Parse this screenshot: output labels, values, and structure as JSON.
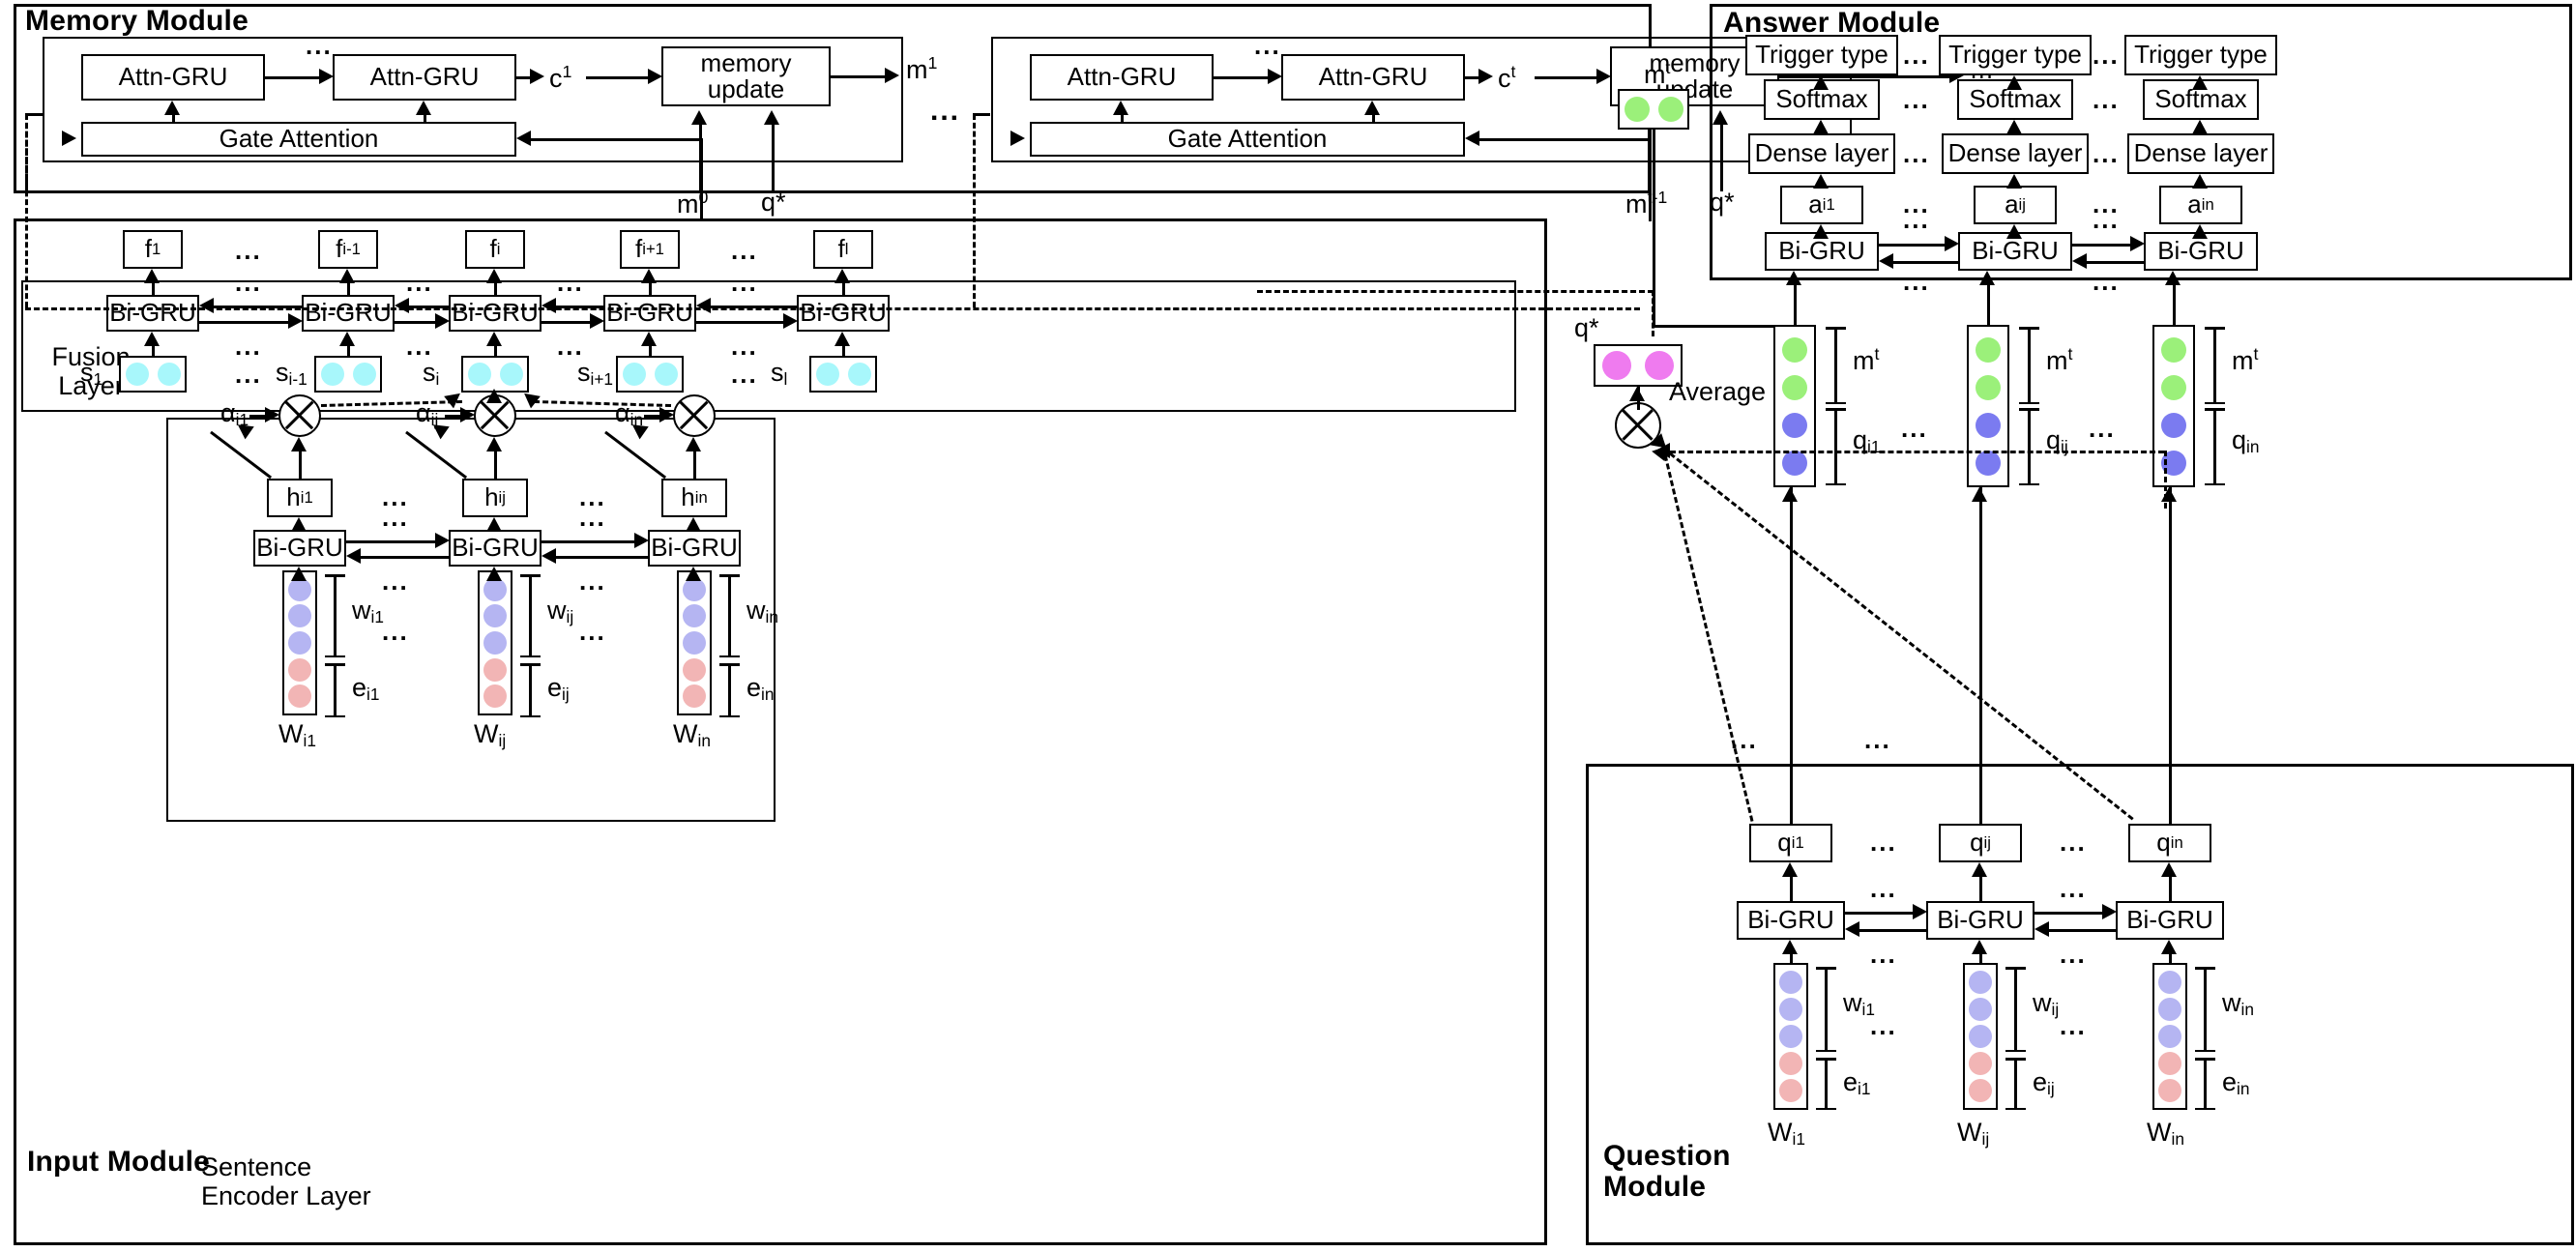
{
  "figure": {
    "type": "neural-network-architecture-diagram",
    "modules": [
      "Memory Module",
      "Answer Module",
      "Input Module",
      "Question Module"
    ]
  },
  "colors": {
    "memory_green": "#9bf07a",
    "question_blue": "#7b7bf0",
    "qstar_magenta": "#ef7bef",
    "sentence_cyan": "#a8f7fb",
    "word_lavender": "#b5b5f2",
    "entity_pink": "#f2b5b5",
    "stroke": "#000000",
    "background": "#ffffff"
  },
  "memory_module": {
    "title": "Memory Module",
    "ellipsis_between_steps": "...",
    "steps": [
      {
        "attn_gru_left": "Attn-GRU",
        "attn_gru_right": "Attn-GRU",
        "inner_dots": "...",
        "context_label": "c1",
        "context_sup": "1",
        "memory_update": "memory\nupdate",
        "memory_out": "m1",
        "memory_out_sup": "1",
        "gate": "Gate Attention",
        "input_prev_memory": "m0",
        "input_prev_memory_sup": "0",
        "input_question": "q*"
      },
      {
        "attn_gru_left": "Attn-GRU",
        "attn_gru_right": "Attn-GRU",
        "inner_dots": "...",
        "context_label": "ct",
        "context_sup": "t",
        "memory_update": "memory\nupdate",
        "memory_out": "mt",
        "memory_out_sup": "t",
        "gate": "Gate Attention",
        "input_prev_memory": "mt-1",
        "input_prev_memory_sup": "t-1",
        "input_question": "q*"
      }
    ]
  },
  "memory_vector": {
    "label": "m",
    "sup": "t",
    "dot_count": 2,
    "color": "#9bf07a"
  },
  "answer_module": {
    "title": "Answer Module",
    "ellipsis": "...",
    "rows": {
      "trigger": "Trigger type",
      "softmax": "Softmax",
      "dense": "Dense layer",
      "bigru": "Bi-GRU"
    },
    "columns": [
      {
        "attention": "a",
        "attention_sub": "i1"
      },
      {
        "attention": "a",
        "attention_sub": "ij"
      },
      {
        "attention": "a",
        "attention_sub": "in"
      }
    ]
  },
  "answer_inputs": [
    {
      "memory_label": "m",
      "memory_sup": "t",
      "question_label": "q",
      "question_sub": "i1",
      "green_dots": 2,
      "blue_dots": 2
    },
    {
      "memory_label": "m",
      "memory_sup": "t",
      "question_label": "q",
      "question_sub": "ij",
      "green_dots": 2,
      "blue_dots": 2
    },
    {
      "memory_label": "m",
      "memory_sup": "t",
      "question_label": "q",
      "question_sub": "in",
      "green_dots": 2,
      "blue_dots": 2
    }
  ],
  "qstar": {
    "label": "q*",
    "average_label": "Average",
    "dot_count": 2,
    "color": "#ef7bef"
  },
  "input_module": {
    "title": "Input Module",
    "fusion_layer_label": "Fusion\nLayer",
    "sentence_encoder_label": "Sentence\nEncoder Layer",
    "bigru_label": "Bi-GRU",
    "ellipsis": "...",
    "fusion_columns": [
      {
        "f": "f",
        "f_sub": "1",
        "s": "s",
        "s_sub": "1"
      },
      {
        "f": "f",
        "f_sub": "i-1",
        "s": "s",
        "s_sub": "i-1"
      },
      {
        "f": "f",
        "f_sub": "i",
        "s": "s",
        "s_sub": "i"
      },
      {
        "f": "f",
        "f_sub": "i+1",
        "s": "s",
        "s_sub": "i+1"
      },
      {
        "f": "f",
        "f_sub": "l",
        "s": "s",
        "s_sub": "l"
      }
    ],
    "encoder_columns": [
      {
        "alpha": "α",
        "alpha_sub": "i1",
        "h": "h",
        "h_sub": "i1",
        "word": "W",
        "word_sub": "i1",
        "w": "w",
        "w_sub": "i1",
        "e": "e",
        "e_sub": "i1"
      },
      {
        "alpha": "α",
        "alpha_sub": "ij",
        "h": "h",
        "h_sub": "ij",
        "word": "W",
        "word_sub": "ij",
        "w": "w",
        "w_sub": "ij",
        "e": "e",
        "e_sub": "ij"
      },
      {
        "alpha": "α",
        "alpha_sub": "in",
        "h": "h",
        "h_sub": "in",
        "word": "W",
        "word_sub": "in",
        "w": "w",
        "w_sub": "in",
        "e": "e",
        "e_sub": "in"
      }
    ],
    "embedding": {
      "lavender_dots": 3,
      "pink_dots": 2
    }
  },
  "question_module": {
    "title": "Question\nModule",
    "bigru_label": "Bi-GRU",
    "ellipsis": "...",
    "columns": [
      {
        "q": "q",
        "q_sub": "i1",
        "word": "W",
        "word_sub": "i1",
        "w": "w",
        "w_sub": "i1",
        "e": "e",
        "e_sub": "i1"
      },
      {
        "q": "q",
        "q_sub": "ij",
        "word": "W",
        "word_sub": "ij",
        "w": "w",
        "w_sub": "ij",
        "e": "e",
        "e_sub": "ij"
      },
      {
        "q": "q",
        "q_sub": "in",
        "word": "W",
        "word_sub": "in",
        "w": "w",
        "w_sub": "in",
        "e": "e",
        "e_sub": "in"
      }
    ],
    "embedding": {
      "lavender_dots": 3,
      "pink_dots": 2
    }
  }
}
